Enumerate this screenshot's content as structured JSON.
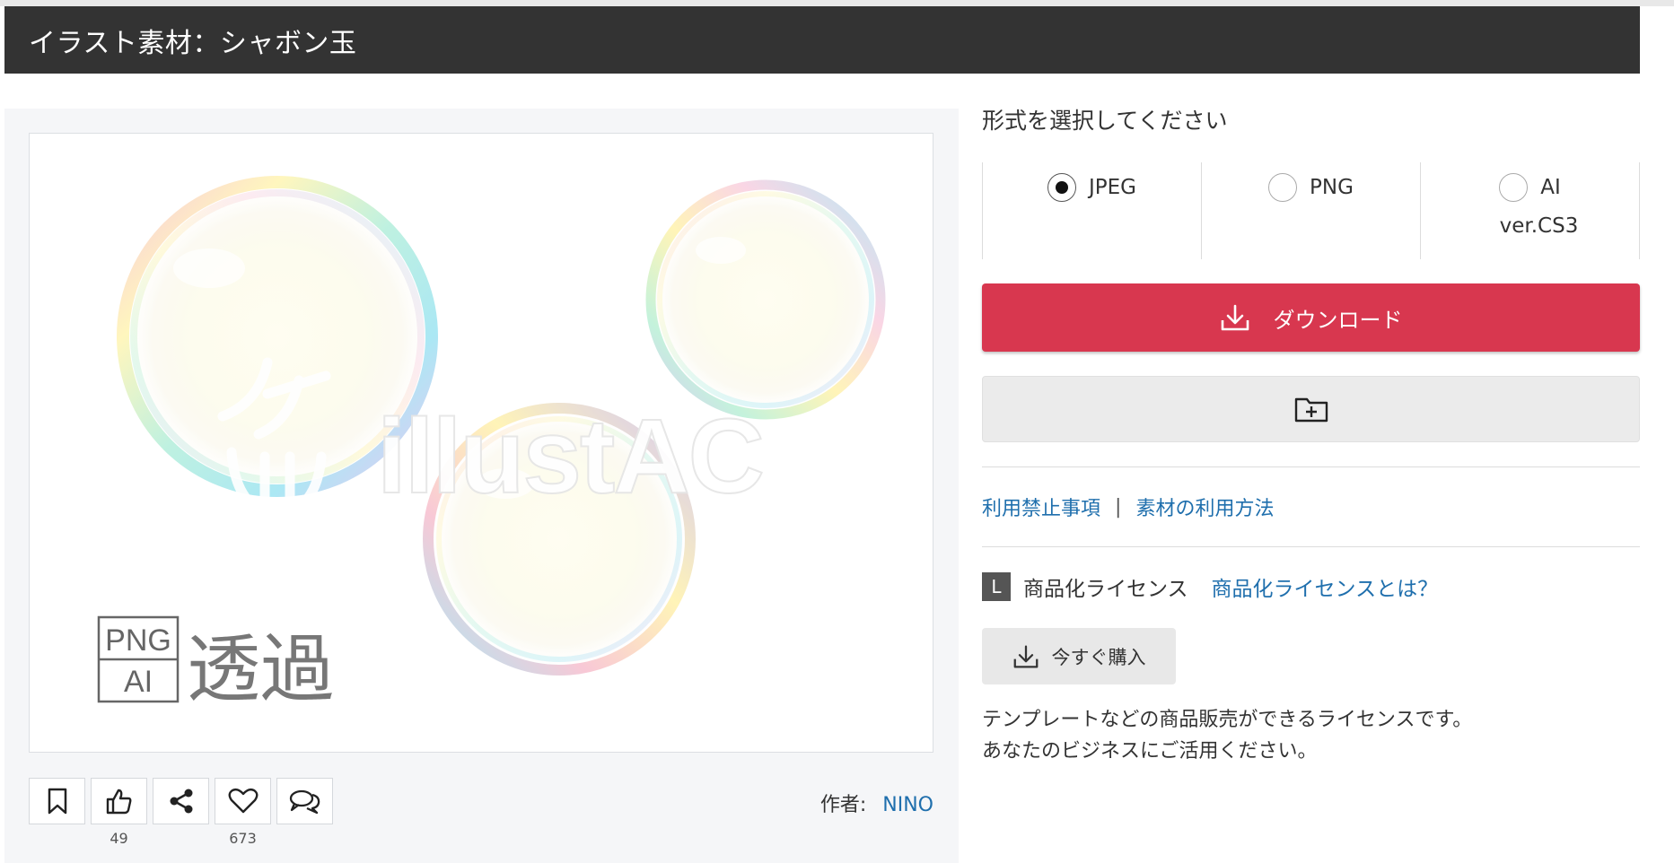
{
  "page": {
    "title": "イラスト素材：シャボン玉"
  },
  "preview": {
    "watermark": "illustAC",
    "badge_top": "PNG",
    "badge_bottom": "AI",
    "badge_label": "透過"
  },
  "actions": [
    {
      "name": "bookmark",
      "icon": "bookmark-icon",
      "count": ""
    },
    {
      "name": "like",
      "icon": "thumbs-up-icon",
      "count": "49"
    },
    {
      "name": "share",
      "icon": "share-icon",
      "count": ""
    },
    {
      "name": "favorite",
      "icon": "heart-icon",
      "count": "673"
    },
    {
      "name": "comment",
      "icon": "comment-icon",
      "count": ""
    }
  ],
  "author": {
    "label": "作者:",
    "name": "NINO"
  },
  "format": {
    "heading": "形式を選択してください",
    "options": [
      {
        "label": "JPEG",
        "selected": true,
        "sub": ""
      },
      {
        "label": "PNG",
        "selected": false,
        "sub": ""
      },
      {
        "label": "AI",
        "selected": false,
        "sub": "ver.CS3"
      }
    ]
  },
  "download": {
    "label": "ダウンロード",
    "icon": "download-icon",
    "color": "#d8374f"
  },
  "folder": {
    "icon": "folder-plus-icon"
  },
  "links": {
    "prohibited": "利用禁止事項",
    "separator": "|",
    "usage": "素材の利用方法"
  },
  "license": {
    "badge": "L",
    "name": "商品化ライセンス",
    "link": "商品化ライセンスとは？",
    "buy_label": "今すぐ購入",
    "desc_line1": "テンプレートなどの商品販売ができるライセンスです。",
    "desc_line2": "あなたのビジネスにご活用ください。"
  }
}
